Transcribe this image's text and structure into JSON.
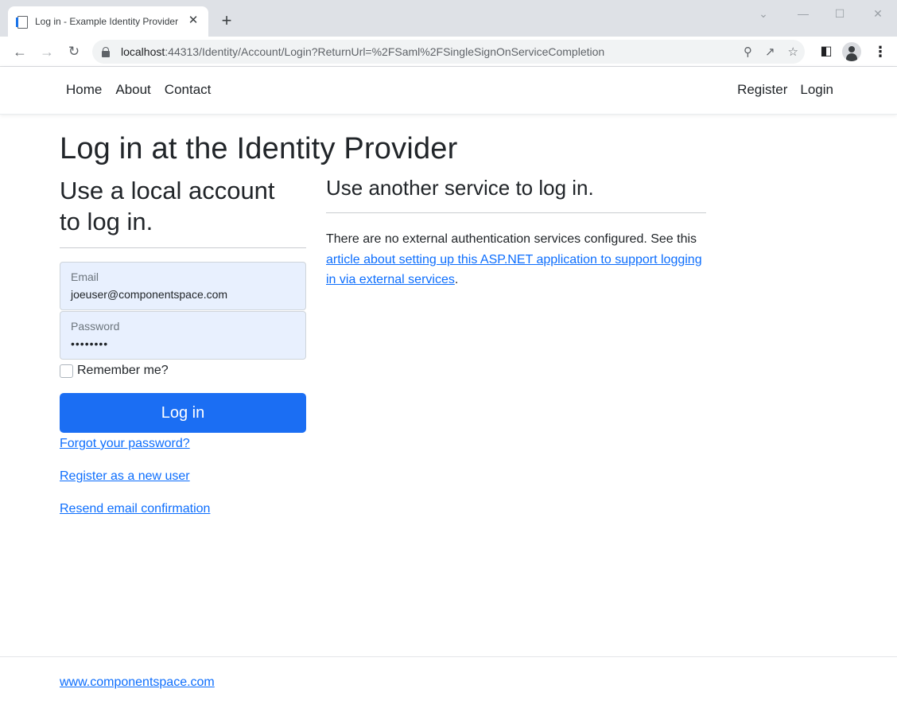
{
  "browser": {
    "tab_title": "Log in - Example Identity Provider",
    "tab_close": "✕",
    "new_tab": "+",
    "url_host": "localhost",
    "url_rest": ":44313/Identity/Account/Login?ReturnUrl=%2FSaml%2FSingleSignOnServiceCompletion"
  },
  "nav": {
    "left": [
      "Home",
      "About",
      "Contact"
    ],
    "right": [
      "Register",
      "Login"
    ]
  },
  "page": {
    "title": "Log in at the Identity Provider",
    "local_heading_line1": "Use a local account",
    "local_heading_line2": "to log in.",
    "email_label": "Email",
    "email_value": "joeuser@componentspace.com",
    "password_label": "Password",
    "password_value": "••••••••",
    "remember_label": "Remember me?",
    "login_button": "Log in",
    "forgot_link": "Forgot your password?",
    "register_link": "Register as a new user",
    "resend_link": "Resend email confirmation",
    "external_heading": "Use another service to log in.",
    "external_text_before": "There are no external authentication services configured. See this ",
    "external_link": "article about setting up this ASP.NET application to support logging in via external services",
    "external_text_after": "."
  },
  "footer": {
    "link": "www.componentspace.com"
  },
  "colors": {
    "primary": "#1b6ef3",
    "link": "#0d6efd",
    "autofill": "#e8f0fe"
  }
}
